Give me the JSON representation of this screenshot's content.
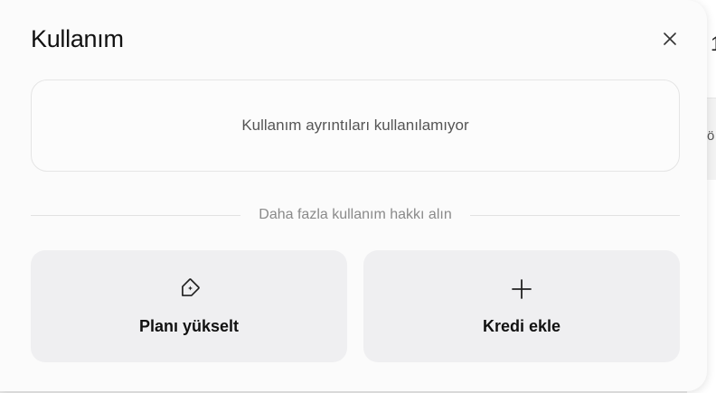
{
  "modal": {
    "title": "Kullanım",
    "close_icon": "close-icon",
    "info_message": "Kullanım ayrıntıları kullanılamıyor",
    "divider_text": "Daha fazla kullanım hakkı alın",
    "actions": [
      {
        "label": "Planı yükselt",
        "icon": "tag-sparkle-icon"
      },
      {
        "label": "Kredi ekle",
        "icon": "plus-icon"
      }
    ]
  },
  "background": {
    "fragment_top": "1",
    "fragment_mid": "ö"
  }
}
